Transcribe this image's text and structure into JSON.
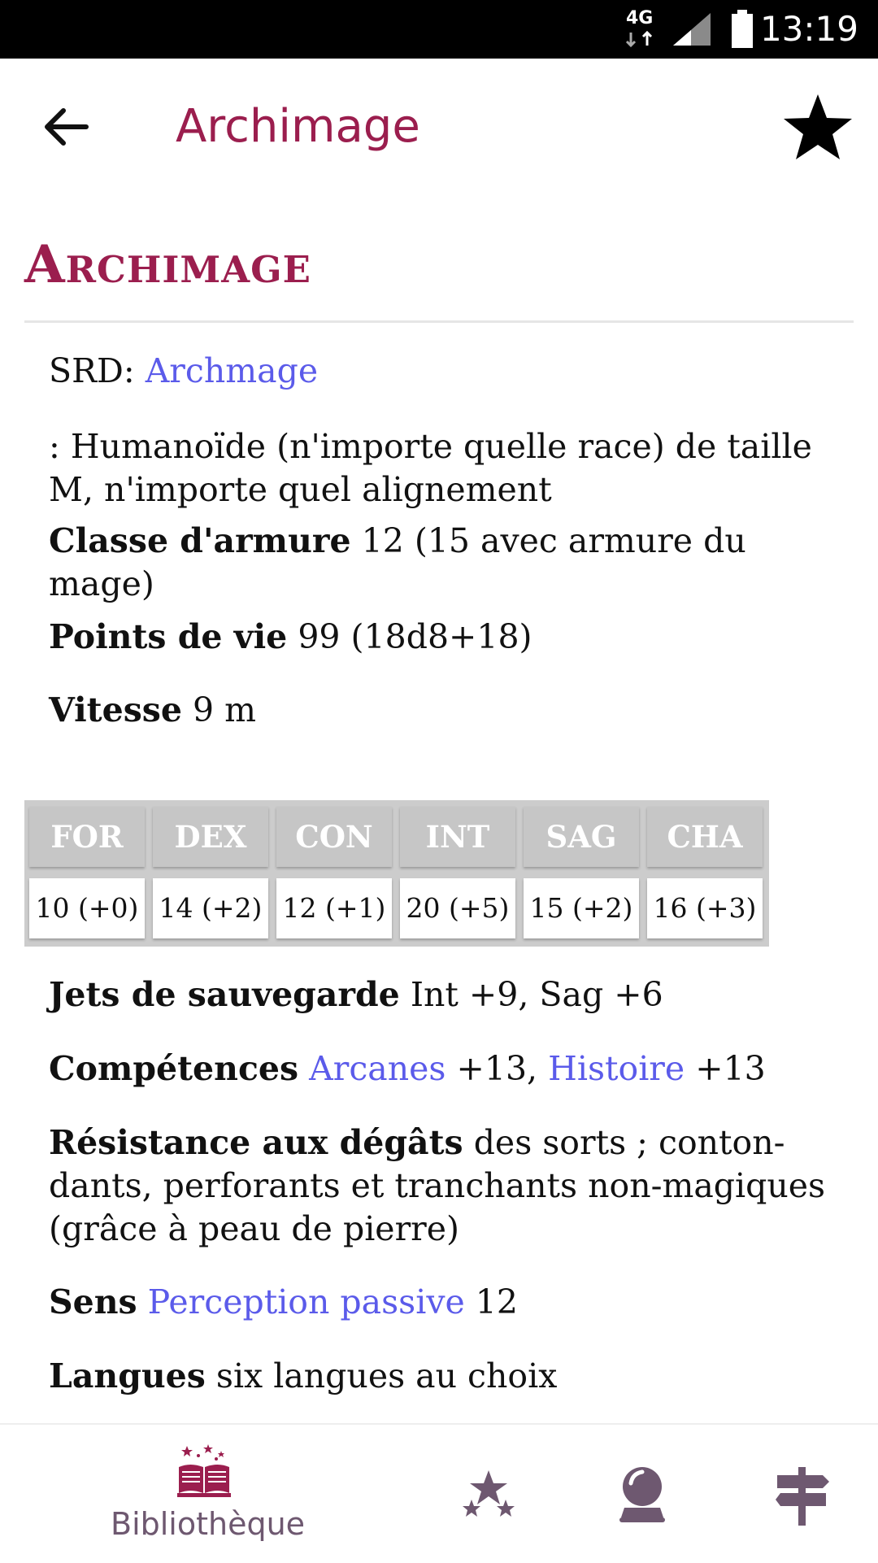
{
  "status_bar": {
    "network": "4G",
    "time": "13:19"
  },
  "app_bar": {
    "title": "Archimage"
  },
  "page": {
    "heading": "Archimage",
    "srd_label": "SRD:",
    "srd_link": "Archmage",
    "type_line_1": ": Humanoïde (n'importe quelle race) de taille",
    "type_line_2": "M, n'importe quel alignement",
    "armor_label": "Classe d'armure",
    "armor_value_1": "12 (15 avec armure du",
    "armor_value_2": "mage)",
    "hp_label": "Points de vie",
    "hp_value": "99 (18d8+18)",
    "speed_label": "Vitesse",
    "speed_value": "9 m",
    "abilities": {
      "headers": [
        "FOR",
        "DEX",
        "CON",
        "INT",
        "SAG",
        "CHA"
      ],
      "values": [
        "10 (+0)",
        "14 (+2)",
        "12 (+1)",
        "20 (+5)",
        "15 (+2)",
        "16 (+3)"
      ]
    },
    "saves_label": "Jets de sauvegarde",
    "saves_value": "Int +9, Sag +6",
    "skills_label": "Compétences",
    "skill_1": "Arcanes",
    "skill_1_value": "+13,",
    "skill_2": "Histoire",
    "skill_2_value": "+13",
    "resist_label": "Résistance aux dégâts",
    "resist_line_1": "des sorts ; conton-",
    "resist_line_2": "dants, perforants et tranchants non-magiques",
    "resist_line_3": "(grâce à peau de pierre)",
    "senses_label": "Sens",
    "senses_link": "Perception passive",
    "senses_value": "12",
    "languages_label": "Langues",
    "languages_value": "six langues au choix"
  },
  "bottom_nav": {
    "items": [
      {
        "label": "Bibliothèque",
        "icon": "library-book-icon"
      },
      {
        "icon": "stars-icon"
      },
      {
        "icon": "crystal-ball-icon"
      },
      {
        "icon": "signpost-icon"
      }
    ]
  },
  "colors": {
    "accent": "#9b1e4e",
    "link": "#5b5bea",
    "nav_icon": "#6e5870"
  }
}
